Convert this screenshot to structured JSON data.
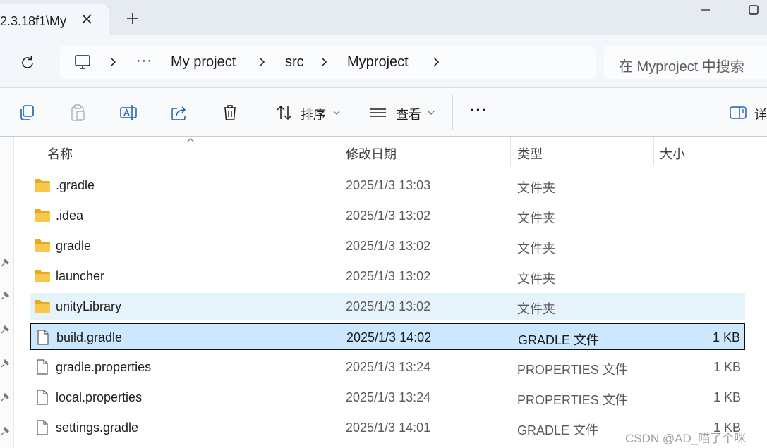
{
  "tab": {
    "title": "2.3.18f1\\My",
    "close_icon": "close-icon",
    "new_tab_icon": "plus-icon"
  },
  "address": {
    "breadcrumbs": [
      "My project",
      "src",
      "Myproject"
    ],
    "overflow": "···",
    "search_placeholder": "在 Myproject 中搜索"
  },
  "toolbar": {
    "sort_label": "排序",
    "view_label": "查看",
    "more_label": "···",
    "details_label": "详"
  },
  "columns": {
    "name": "名称",
    "modified": "修改日期",
    "type": "类型",
    "size": "大小"
  },
  "files": [
    {
      "name": ".gradle",
      "modified": "2025/1/3 13:03",
      "type": "文件夹",
      "size": "",
      "icon": "folder-icon",
      "state": "normal"
    },
    {
      "name": ".idea",
      "modified": "2025/1/3 13:02",
      "type": "文件夹",
      "size": "",
      "icon": "folder-icon",
      "state": "normal"
    },
    {
      "name": "gradle",
      "modified": "2025/1/3 13:02",
      "type": "文件夹",
      "size": "",
      "icon": "folder-icon",
      "state": "normal"
    },
    {
      "name": "launcher",
      "modified": "2025/1/3 13:02",
      "type": "文件夹",
      "size": "",
      "icon": "folder-icon",
      "state": "normal"
    },
    {
      "name": "unityLibrary",
      "modified": "2025/1/3 13:02",
      "type": "文件夹",
      "size": "",
      "icon": "folder-icon",
      "state": "hover"
    },
    {
      "name": "build.gradle",
      "modified": "2025/1/3 14:02",
      "type": "GRADLE 文件",
      "size": "1 KB",
      "icon": "file-icon",
      "state": "selected"
    },
    {
      "name": "gradle.properties",
      "modified": "2025/1/3 13:24",
      "type": "PROPERTIES 文件",
      "size": "1 KB",
      "icon": "file-icon",
      "state": "normal"
    },
    {
      "name": "local.properties",
      "modified": "2025/1/3 13:24",
      "type": "PROPERTIES 文件",
      "size": "1 KB",
      "icon": "file-icon",
      "state": "normal"
    },
    {
      "name": "settings.gradle",
      "modified": "2025/1/3 14:01",
      "type": "GRADLE 文件",
      "size": "1 KB",
      "icon": "file-icon",
      "state": "normal"
    }
  ],
  "watermark": "CSDN @AD_喵了个咪",
  "colors": {
    "selected_bg": "#cce8ff",
    "hover_bg": "#e5f3fb",
    "folder": "#f8c84a",
    "accent": "#1a5fb4"
  }
}
